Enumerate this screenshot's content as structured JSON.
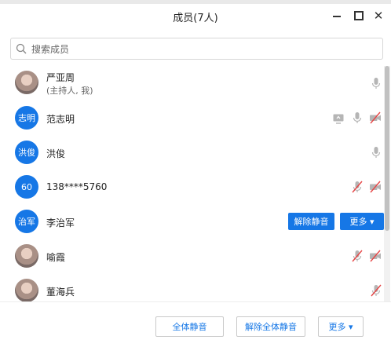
{
  "window": {
    "title": "成员(7人)",
    "close_glyph": "✕"
  },
  "search": {
    "placeholder": "搜索成员",
    "value": ""
  },
  "members": [
    {
      "name": "严亚周",
      "sub": "(主持人, 我)",
      "avatar": "photo",
      "status_icons": [
        "mic-icon"
      ]
    },
    {
      "name": "范志明",
      "avatar_text": "志明",
      "avatar": "blue",
      "status_icons": [
        "screen-share-icon",
        "mic-icon",
        "camera-off-icon"
      ]
    },
    {
      "name": "洪俊",
      "avatar_text": "洪俊",
      "avatar": "blue",
      "status_icons": [
        "mic-icon"
      ]
    },
    {
      "name": "138****5760",
      "avatar_text": "60",
      "avatar": "blue",
      "status_icons": [
        "mic-muted-icon",
        "camera-off-icon"
      ]
    },
    {
      "name": "李治军",
      "avatar_text": "治军",
      "avatar": "blue",
      "actions": {
        "unmute": "解除静音",
        "more": "更多 ▾"
      }
    },
    {
      "name": "喻霞",
      "avatar": "photo",
      "status_icons": [
        "mic-muted-icon",
        "camera-off-icon"
      ]
    },
    {
      "name": "董海兵",
      "avatar": "photo",
      "status_icons": [
        "mic-muted-icon"
      ]
    }
  ],
  "footer": {
    "mute_all": "全体静音",
    "unmute_all": "解除全体静音",
    "more": "更多 ▾"
  },
  "colors": {
    "accent": "#1677e6",
    "muted_red": "#e64545",
    "icon_gray": "#b5b5b5"
  }
}
